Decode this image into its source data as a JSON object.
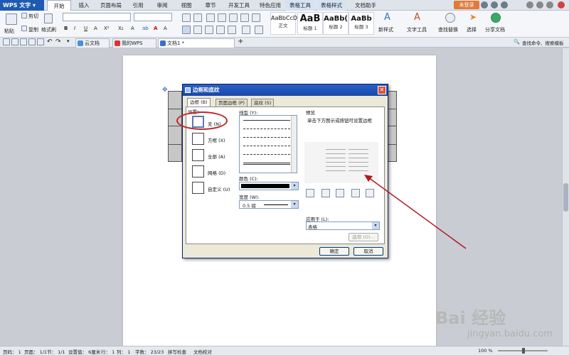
{
  "app": {
    "logo": "WPS 文字"
  },
  "menu": {
    "tabs": [
      "开始",
      "插入",
      "页面布局",
      "引用",
      "审阅",
      "视图",
      "章节",
      "开发工具",
      "特色应用",
      "表格工具",
      "表格样式",
      "文档助手"
    ],
    "login": "未登录"
  },
  "ribbon": {
    "paste": "粘贴",
    "cut": "剪切",
    "copy": "复制",
    "format_painter": "格式刷",
    "style_sample": "AaBbCcDd",
    "style_normal": "正文",
    "heading1_sample": "AaB",
    "heading1": "标题 1",
    "heading2_sample": "AaBb(",
    "heading2": "标题 2",
    "heading3_sample": "AaBb",
    "heading3": "标题 3",
    "new_style": "新样式",
    "text_tools": "文字工具",
    "find_replace": "查找替换",
    "select": "选择",
    "share": "分享文档"
  },
  "quickbar": {
    "tab_cloud": "云文档",
    "tab_mywps": "我的WPS",
    "tab_doc": "文档1 *",
    "search": "查找命令、搜索模板"
  },
  "dialog": {
    "title": "边框和底纹",
    "tabs": [
      "边框 (B)",
      "页面边框 (P)",
      "底纹 (S)"
    ],
    "setting_label": "设置：",
    "settings": [
      "无 (N)",
      "方框 (X)",
      "全部 (A)",
      "网格 (D)",
      "自定义 (U)"
    ],
    "linetype_label": "线型 (Y):",
    "color_label": "颜色 (C):",
    "width_label": "宽度 (W):",
    "width_value": "0.5  磅",
    "preview_label": "预览",
    "preview_hint": "单击下方图示或按钮可设置边框",
    "apply_label": "应用于 (L):",
    "apply_value": "表格",
    "options_button": "选项 (O)...",
    "ok": "确定",
    "cancel": "取消"
  },
  "status": {
    "page": "页码： 1",
    "pages": "页面： 1/1",
    "section": "节： 1/1",
    "setvalue": "设置值： 6厘米",
    "row": "行： 1",
    "col": "列： 1",
    "words": "字数： 23/23",
    "spell": "拼写检查",
    "compare": "文档校对",
    "zoom": "100 %"
  },
  "watermark": {
    "main": "Bai 经验",
    "sub": "jingyan.baidu.com"
  },
  "colors": {
    "accent": "#1e5bb0",
    "annotation": "#c0262a"
  }
}
